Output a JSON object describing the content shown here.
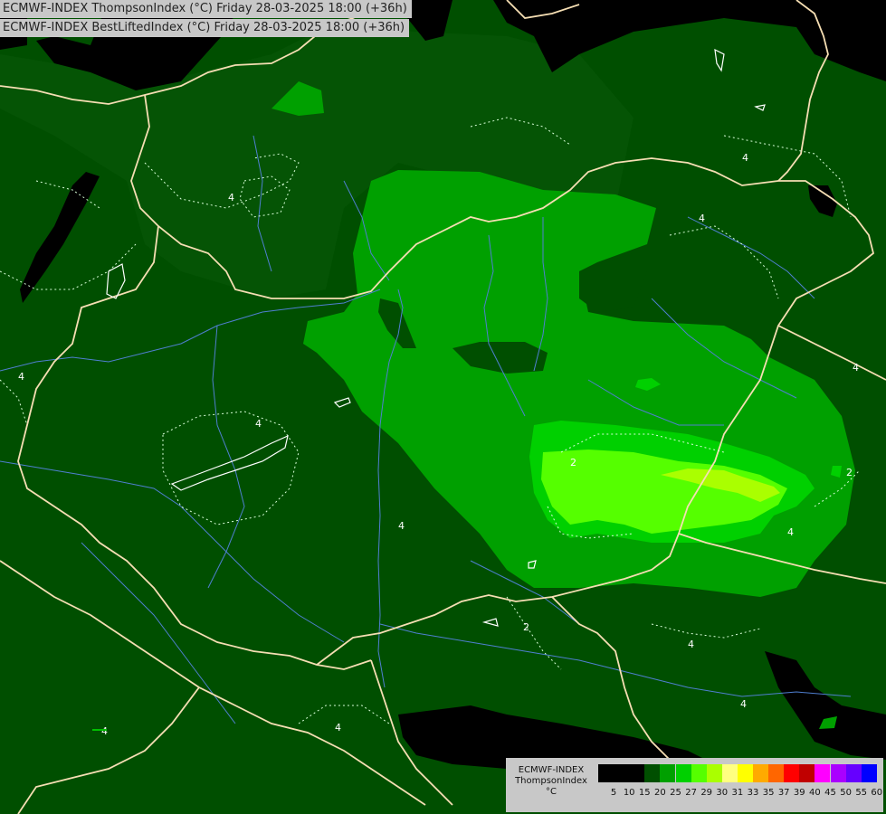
{
  "header": {
    "line1": "ECMWF-INDEX ThompsonIndex (°C) Friday 28-03-2025 18:00 (+36h)",
    "line2": "ECMWF-INDEX BestLiftedIndex (°C) Friday 28-03-2025 18:00 (+36h)"
  },
  "legend": {
    "model": "ECMWF-INDEX",
    "parameter": "ThompsonIndex",
    "unit": "°C",
    "classes": [
      {
        "label": "5",
        "color": "#000000"
      },
      {
        "label": "10",
        "color": "#000000"
      },
      {
        "label": "15",
        "color": "#000000"
      },
      {
        "label": "20",
        "color": "#004f00"
      },
      {
        "label": "25",
        "color": "#00a000"
      },
      {
        "label": "27",
        "color": "#00d000"
      },
      {
        "label": "29",
        "color": "#55ff00"
      },
      {
        "label": "30",
        "color": "#aaff00"
      },
      {
        "label": "31",
        "color": "#ffff80"
      },
      {
        "label": "33",
        "color": "#ffff00"
      },
      {
        "label": "35",
        "color": "#ffaa00"
      },
      {
        "label": "37",
        "color": "#ff6600"
      },
      {
        "label": "39",
        "color": "#ff0000"
      },
      {
        "label": "40",
        "color": "#c00000"
      },
      {
        "label": "45",
        "color": "#ff00ff"
      },
      {
        "label": "50",
        "color": "#aa00ff"
      },
      {
        "label": "55",
        "color": "#6600ff"
      },
      {
        "label": "60",
        "color": "#0000ff"
      }
    ]
  },
  "contour_labels": [
    "4",
    "4",
    "4",
    "4",
    "4",
    "4",
    "4",
    "2",
    "2",
    "2",
    "4",
    "4",
    "4",
    "4",
    "4"
  ],
  "colors": {
    "background": "#004f00",
    "level_25": "#00a000",
    "level_27": "#00d000",
    "level_29": "#55ff00",
    "level_30": "#aaff00",
    "dark": "#000000",
    "borders": "#f5deb3",
    "rivers": "#4f7fd0"
  }
}
